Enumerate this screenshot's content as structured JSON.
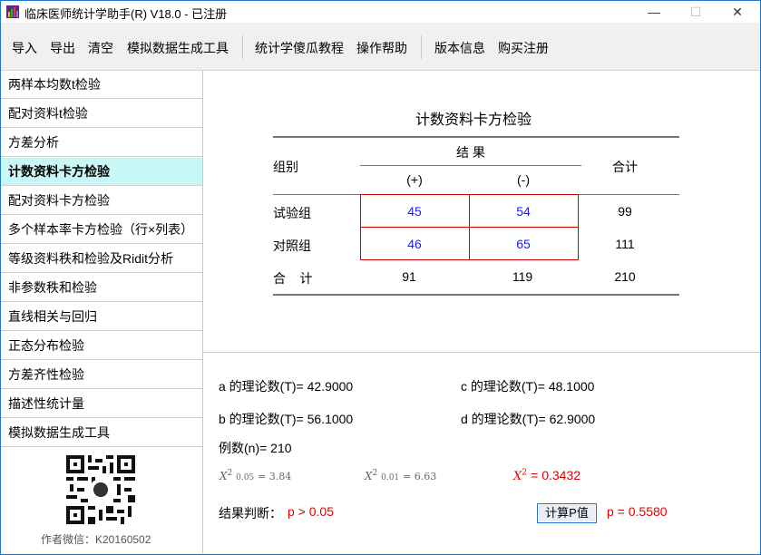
{
  "window": {
    "title": "临床医师统计学助手(R) V18.0 - 已注册",
    "minimize": "—",
    "maximize": "☐",
    "close": "✕"
  },
  "menu": [
    "导入",
    "导出",
    "清空",
    "模拟数据生成工具",
    "统计学傻瓜教程",
    "操作帮助",
    "版本信息",
    "购买注册"
  ],
  "sidebar": {
    "items": [
      "两样本均数t检验",
      "配对资料t检验",
      "方差分析",
      "计数资料卡方检验",
      "配对资料卡方检验",
      "多个样本率卡方检验（行×列表）",
      "等级资料秩和检验及Ridit分析",
      "非参数秩和检验",
      "直线相关与回归",
      "正态分布检验",
      "方差齐性检验",
      "描述性统计量",
      "模拟数据生成工具"
    ],
    "active_index": 3,
    "author": "作者微信：K20160502"
  },
  "table": {
    "title": "计数资料卡方检验",
    "group_header": "组别",
    "result_header": "结  果",
    "pos": "(+)",
    "neg": "(-)",
    "total_header": "合计",
    "rows": [
      {
        "label": "试验组",
        "pos": "45",
        "neg": "54",
        "total": "99"
      },
      {
        "label": "对照组",
        "pos": "46",
        "neg": "65",
        "total": "111"
      }
    ],
    "sum_row": {
      "label": "合    计",
      "pos": "91",
      "neg": "119",
      "total": "210"
    }
  },
  "results": {
    "a": "a 的理论数(T)= 42.9000",
    "b": "b 的理论数(T)= 56.1000",
    "c": "c 的理论数(T)= 48.1000",
    "d": "d 的理论数(T)= 62.9000",
    "n": "例数(n)=  210",
    "chi_05_sub": "0.05",
    "chi_05_val": "= 3.84",
    "chi_01_sub": "0.01",
    "chi_01_val": "= 6.63",
    "chi_value": "=  0.3432",
    "judge_label": "结果判断：",
    "judge_value": "p > 0.05",
    "calc_button": "计算P值",
    "p_value": "p = 0.5580"
  },
  "colors": {
    "accent": "#1a1aff",
    "warning": "#e00000",
    "active_bg": "#c9f7f7",
    "border_red": "#d40000"
  }
}
